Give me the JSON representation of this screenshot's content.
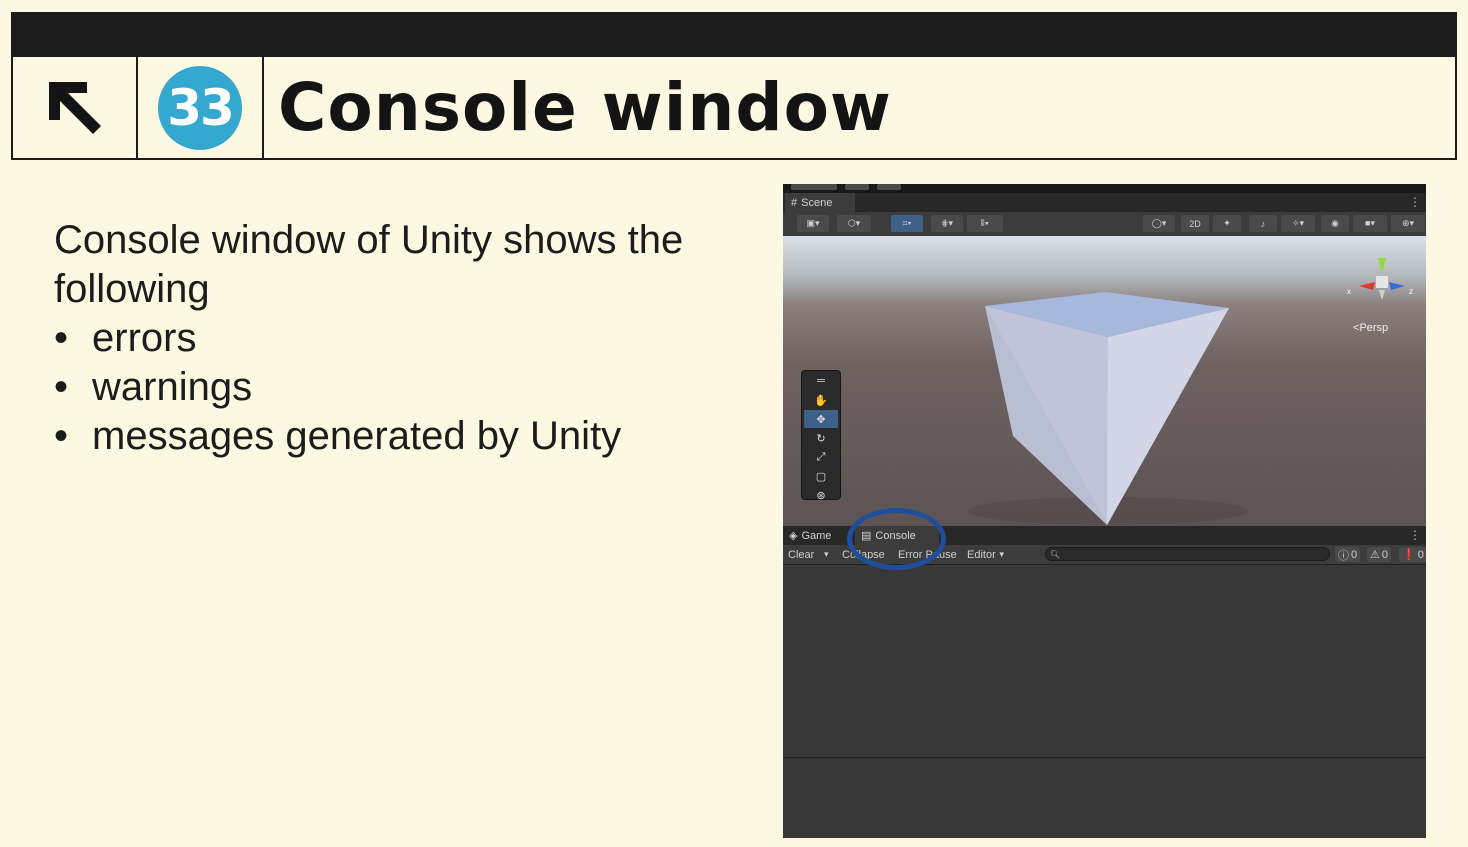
{
  "header": {
    "nav_icon": "arrow-up-left-icon",
    "number": "33",
    "title": "Console window"
  },
  "content": {
    "intro": "Console window of Unity shows the following",
    "bullets": [
      "errors",
      "warnings",
      "messages generated by Unity"
    ]
  },
  "unity": {
    "scene_tab": "Scene",
    "toolbar_2d": "2D",
    "persp_label": "Persp",
    "axis_x": "x",
    "axis_z": "z",
    "game_tab": "Game",
    "console_tab": "Console",
    "console_toolbar": {
      "clear": "Clear",
      "collapse": "Collapse",
      "error_pause": "Error Pause",
      "editor": "Editor"
    },
    "counts": {
      "messages": "0",
      "warnings": "0",
      "errors": "0"
    }
  },
  "colors": {
    "background": "#fdf8e2",
    "header_bar": "#1c1c1c",
    "badge": "#35a8d0",
    "highlight_circle": "#1f4f9c"
  }
}
